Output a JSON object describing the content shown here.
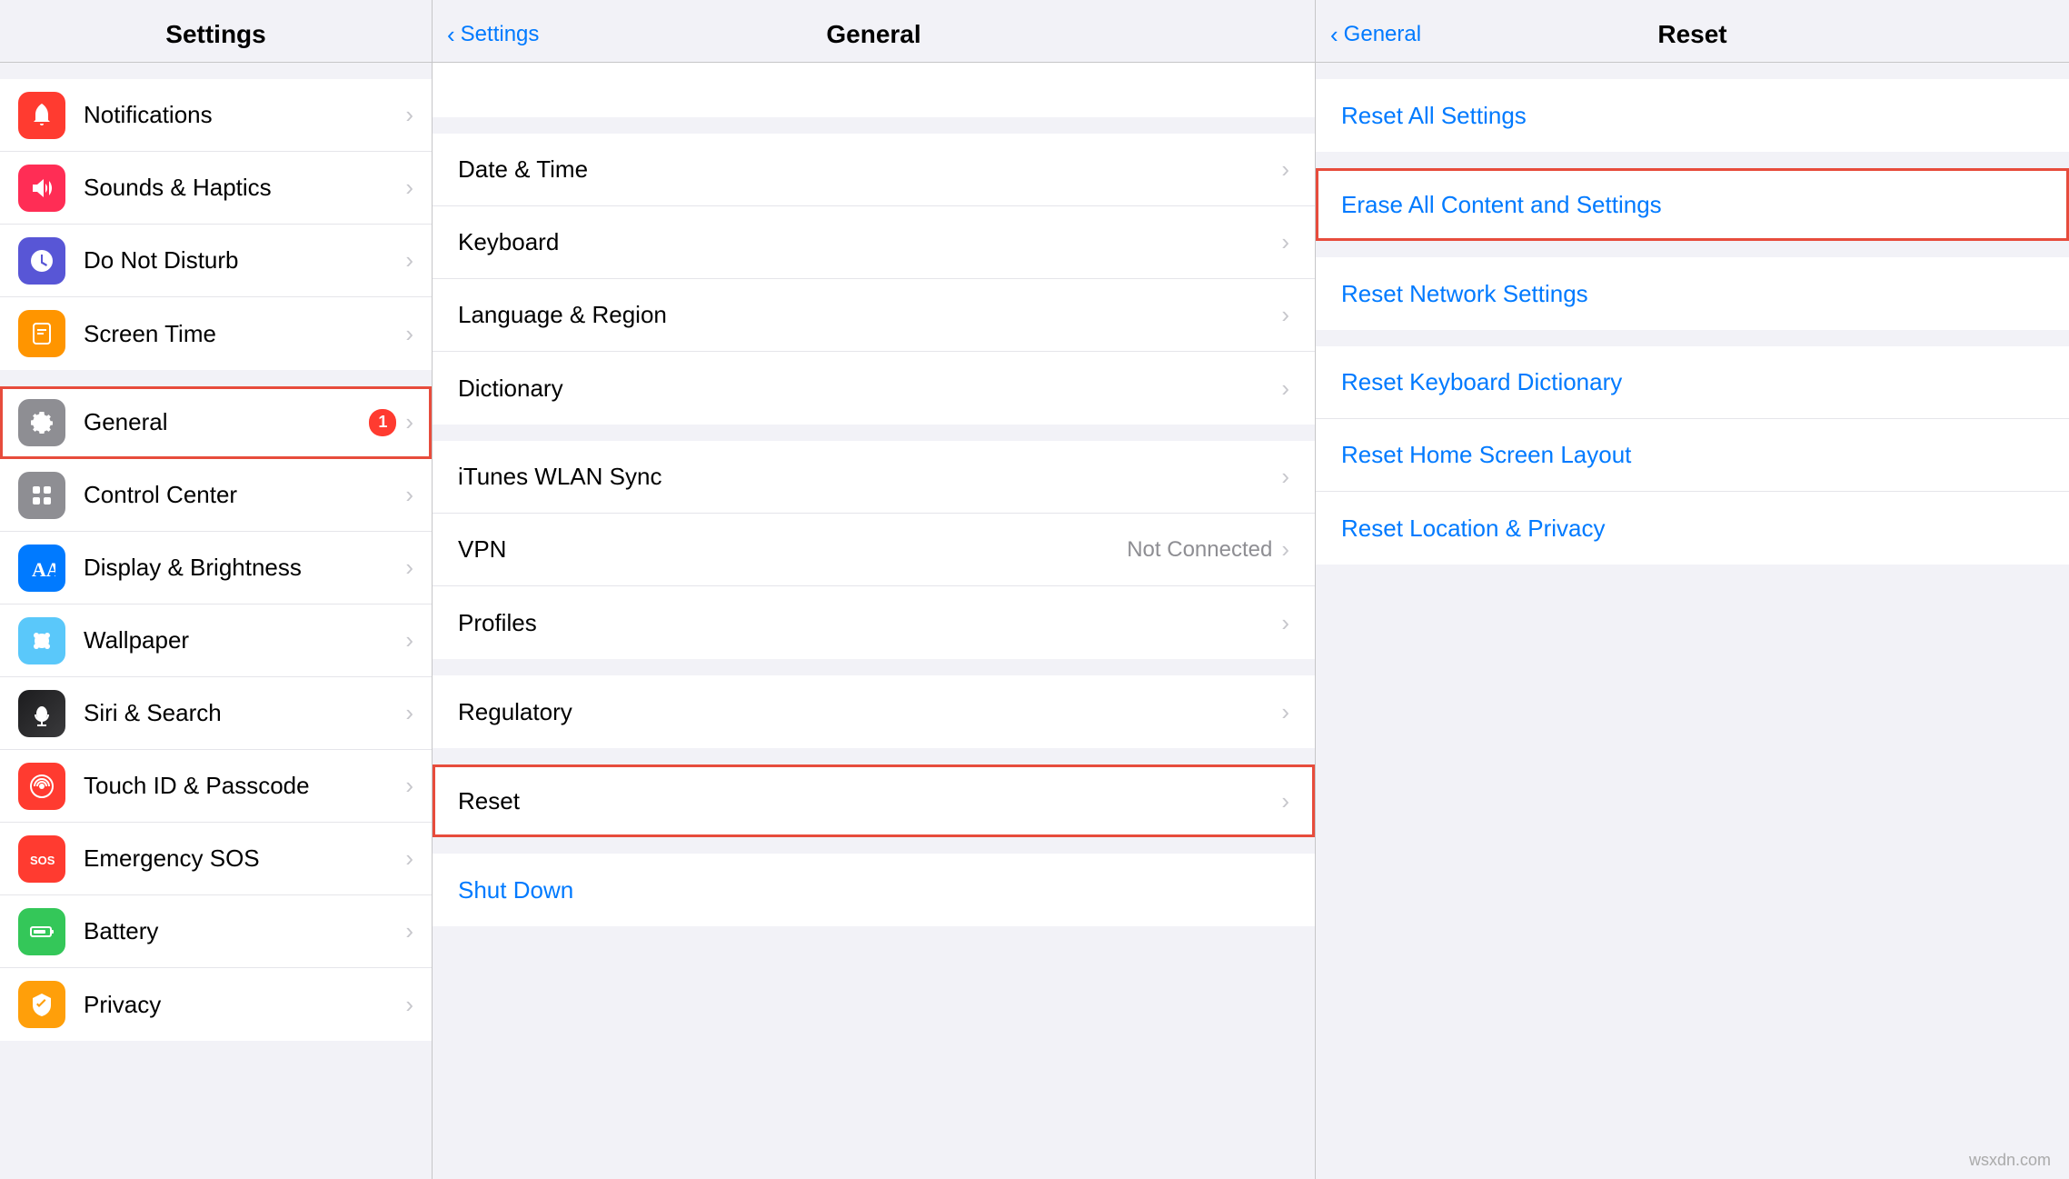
{
  "left": {
    "title": "Settings",
    "sections": [
      {
        "items": [
          {
            "id": "notifications",
            "label": "Notifications",
            "icon": "🔔",
            "iconClass": "icon-red",
            "badge": null
          },
          {
            "id": "sounds",
            "label": "Sounds & Haptics",
            "icon": "🔊",
            "iconClass": "icon-red2",
            "badge": null
          },
          {
            "id": "donotdisturb",
            "label": "Do Not Disturb",
            "icon": "🌙",
            "iconClass": "icon-purple",
            "badge": null
          },
          {
            "id": "screentime",
            "label": "Screen Time",
            "icon": "⏳",
            "iconClass": "icon-orange",
            "badge": null
          }
        ]
      },
      {
        "items": [
          {
            "id": "general",
            "label": "General",
            "icon": "⚙️",
            "iconClass": "icon-gray",
            "badge": "1",
            "selected": true
          },
          {
            "id": "controlcenter",
            "label": "Control Center",
            "icon": "⊞",
            "iconClass": "icon-gray",
            "badge": null
          },
          {
            "id": "displaybrightness",
            "label": "Display & Brightness",
            "icon": "AA",
            "iconClass": "icon-blue",
            "badge": null
          },
          {
            "id": "wallpaper",
            "label": "Wallpaper",
            "icon": "❊",
            "iconClass": "icon-teal",
            "badge": null
          },
          {
            "id": "sirisearch",
            "label": "Siri & Search",
            "icon": "◎",
            "iconClass": "icon-siri",
            "badge": null
          },
          {
            "id": "touchid",
            "label": "Touch ID & Passcode",
            "icon": "◉",
            "iconClass": "icon-touch",
            "badge": null
          },
          {
            "id": "emergencysos",
            "label": "Emergency SOS",
            "icon": "SOS",
            "iconClass": "icon-sos",
            "badge": null
          },
          {
            "id": "battery",
            "label": "Battery",
            "icon": "▮",
            "iconClass": "icon-battery",
            "badge": null
          },
          {
            "id": "privacy",
            "label": "Privacy",
            "icon": "✋",
            "iconClass": "icon-privacy",
            "badge": null
          }
        ]
      }
    ]
  },
  "middle": {
    "title": "General",
    "back_label": "Settings",
    "sections": [
      {
        "items": [
          {
            "id": "datetime",
            "label": "Date & Time",
            "value": ""
          },
          {
            "id": "keyboard",
            "label": "Keyboard",
            "value": ""
          },
          {
            "id": "language",
            "label": "Language & Region",
            "value": ""
          },
          {
            "id": "dictionary",
            "label": "Dictionary",
            "value": ""
          }
        ]
      },
      {
        "items": [
          {
            "id": "ituneswlan",
            "label": "iTunes WLAN Sync",
            "value": ""
          },
          {
            "id": "vpn",
            "label": "VPN",
            "value": "Not Connected"
          },
          {
            "id": "profiles",
            "label": "Profiles",
            "value": ""
          }
        ]
      },
      {
        "items": [
          {
            "id": "regulatory",
            "label": "Regulatory",
            "value": ""
          }
        ]
      },
      {
        "items": [
          {
            "id": "reset",
            "label": "Reset",
            "value": "",
            "selected": true
          }
        ]
      },
      {
        "items": [
          {
            "id": "shutdown",
            "label": "Shut Down",
            "value": "",
            "blue": true,
            "noChevron": true
          }
        ]
      }
    ]
  },
  "right": {
    "title": "Reset",
    "back_label": "General",
    "sections": [
      {
        "items": [
          {
            "id": "resetall",
            "label": "Reset All Settings"
          }
        ]
      },
      {
        "items": [
          {
            "id": "eraseall",
            "label": "Erase All Content and Settings",
            "selected": true
          }
        ]
      },
      {
        "items": [
          {
            "id": "resetnetwork",
            "label": "Reset Network Settings"
          }
        ]
      },
      {
        "items": [
          {
            "id": "resetkeyboard",
            "label": "Reset Keyboard Dictionary"
          },
          {
            "id": "resethome",
            "label": "Reset Home Screen Layout"
          },
          {
            "id": "resetlocation",
            "label": "Reset Location & Privacy"
          }
        ]
      }
    ]
  },
  "watermark": "wsxdn.com"
}
